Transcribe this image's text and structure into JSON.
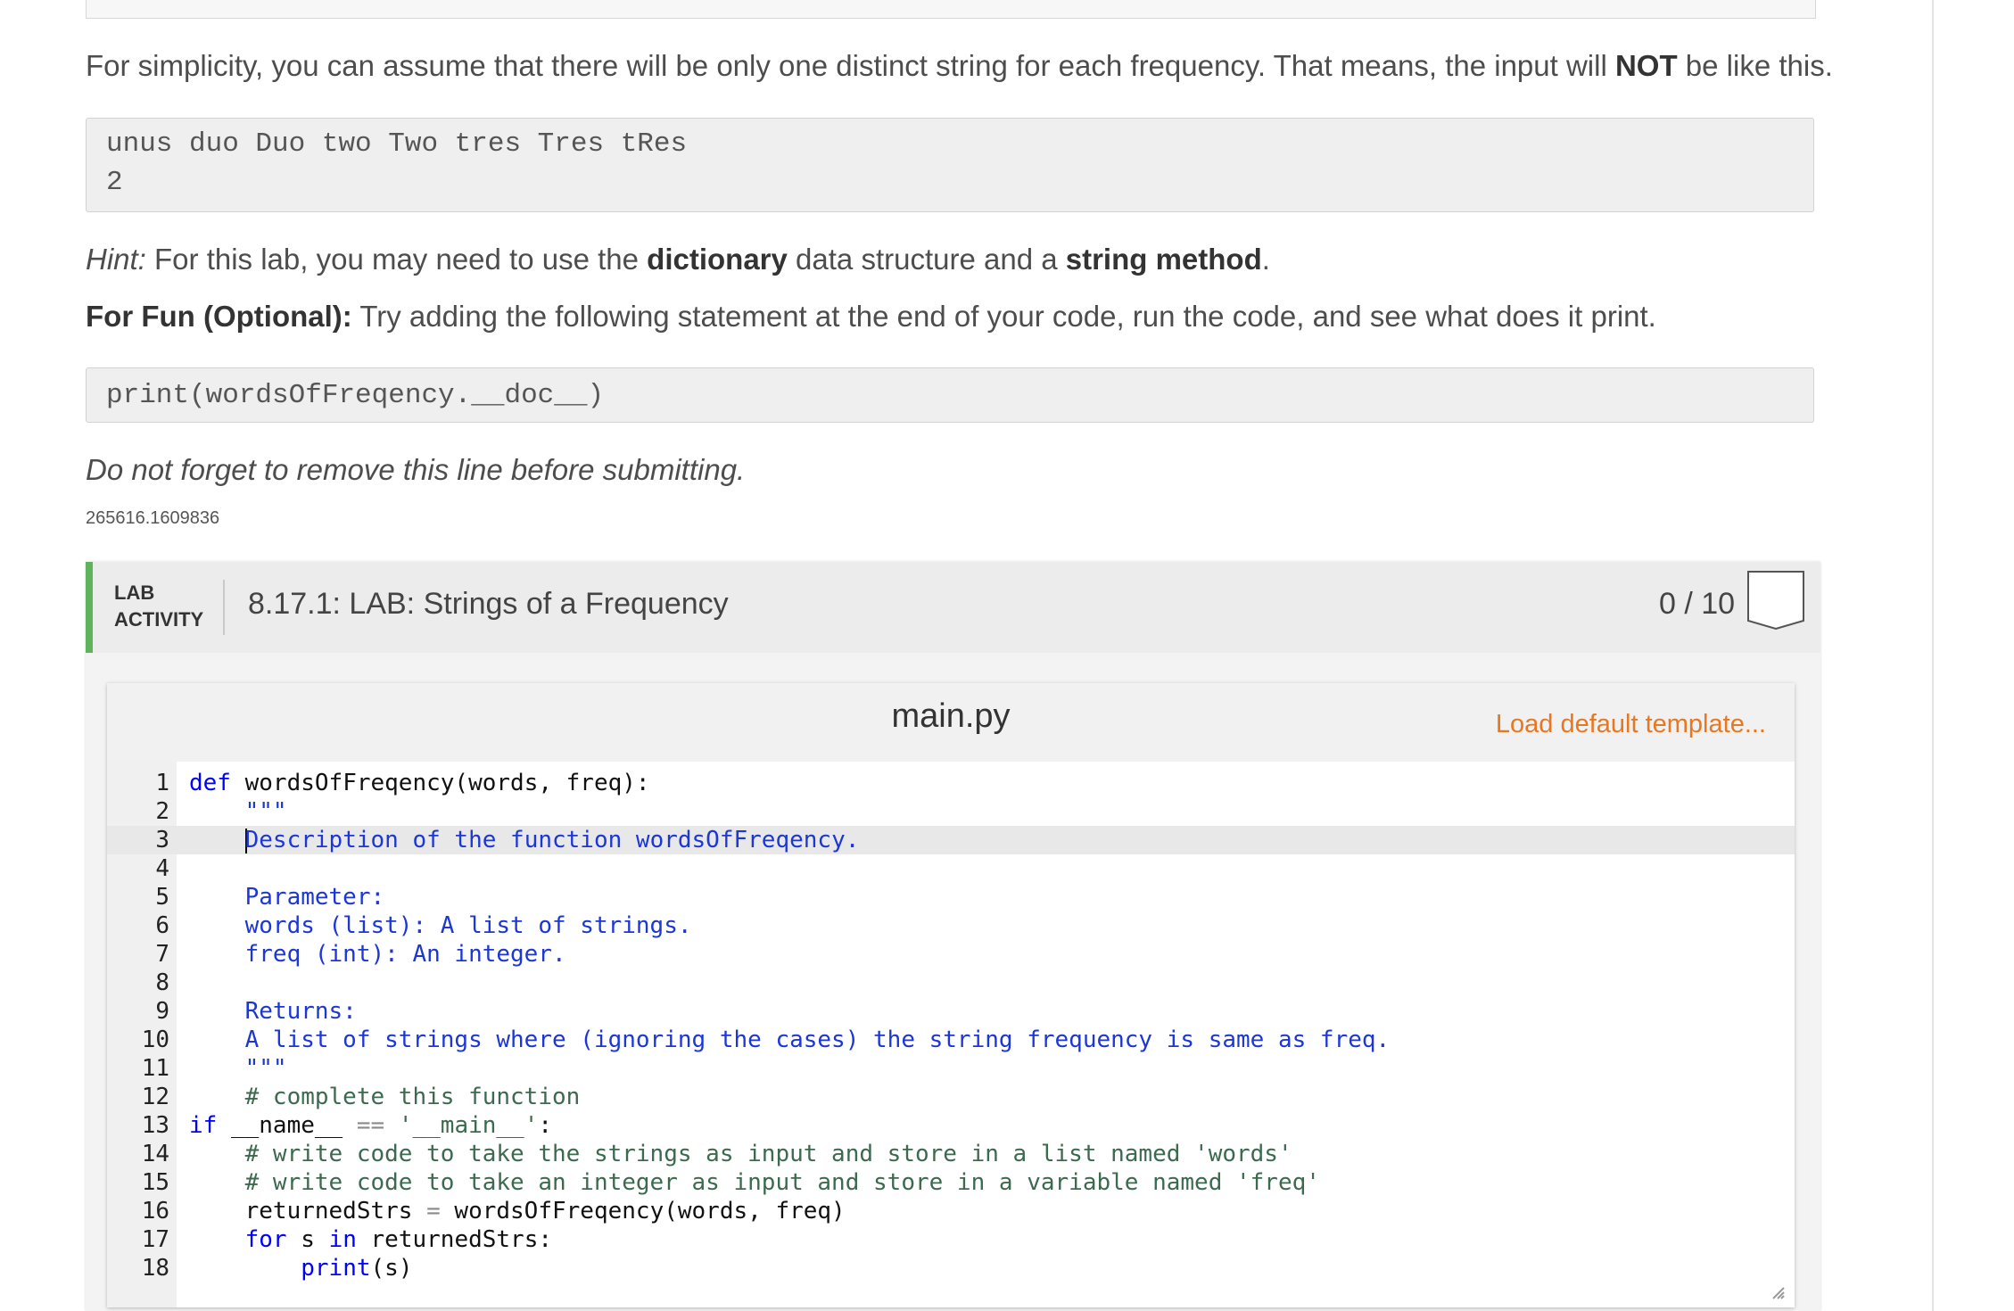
{
  "instructions": {
    "simplicity_text_before": "For simplicity, you can assume that there will be only one distinct string for each frequency. That means, the input will ",
    "simplicity_emph": "NOT",
    "simplicity_text_after": " be like this.",
    "example_input_line1": "unus duo Duo two Two tres Tres tRes",
    "example_input_line2": "2",
    "hint_label": "Hint:",
    "hint_text_1": " For this lab, you may need to use the ",
    "hint_bold_1": "dictionary",
    "hint_text_2": " data structure and a ",
    "hint_bold_2": "string method",
    "hint_text_3": ".",
    "fun_label": "For Fun (Optional):",
    "fun_text": " Try adding the following statement at the end of your code, run the code, and see what does it print.",
    "fun_code": "print(wordsOfFreqency.__doc__)",
    "remove_note": "Do not forget to remove this line before submitting.",
    "id_text": "265616.1609836"
  },
  "lab": {
    "kind_line1": "LAB",
    "kind_line2": "ACTIVITY",
    "title": "8.17.1: LAB: Strings of a Frequency",
    "score": "0 / 10",
    "accent_color": "#5fb35d"
  },
  "editor": {
    "file_name": "main.py",
    "load_template_label": "Load default template...",
    "active_line": 3,
    "lines": [
      {
        "n": "1",
        "t": "def wordsOfFreqency(words, freq):"
      },
      {
        "n": "2",
        "t": "    \"\"\""
      },
      {
        "n": "3",
        "t": "    Description of the function wordsOfFreqency."
      },
      {
        "n": "4",
        "t": ""
      },
      {
        "n": "5",
        "t": "    Parameter:"
      },
      {
        "n": "6",
        "t": "    words (list): A list of strings."
      },
      {
        "n": "7",
        "t": "    freq (int): An integer."
      },
      {
        "n": "8",
        "t": ""
      },
      {
        "n": "9",
        "t": "    Returns:"
      },
      {
        "n": "10",
        "t": "    A list of strings where (ignoring the cases) the string frequency is same as freq."
      },
      {
        "n": "11",
        "t": "    \"\"\""
      },
      {
        "n": "12",
        "t": "    # complete this function"
      },
      {
        "n": "13",
        "t": "if __name__ == '__main__':"
      },
      {
        "n": "14",
        "t": "    # write code to take the strings as input and store in a list named 'words'"
      },
      {
        "n": "15",
        "t": "    # write code to take an integer as input and store in a variable named 'freq'"
      },
      {
        "n": "16",
        "t": "    returnedStrs = wordsOfFreqency(words, freq)"
      },
      {
        "n": "17",
        "t": "    for s in returnedStrs:"
      },
      {
        "n": "18",
        "t": "        print(s)"
      }
    ]
  }
}
